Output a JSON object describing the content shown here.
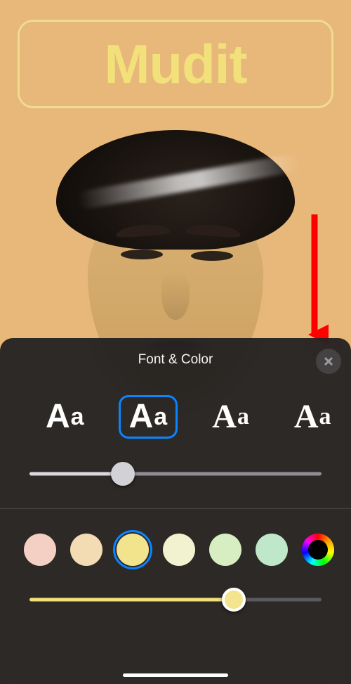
{
  "editor": {
    "name_text": "Mudit"
  },
  "arrow": {
    "color": "#ff0000"
  },
  "sheet": {
    "title": "Font & Color",
    "fonts": [
      {
        "label_big": "A",
        "label_small": "a",
        "style": "sans",
        "selected": false
      },
      {
        "label_big": "A",
        "label_small": "a",
        "style": "rounded",
        "selected": true
      },
      {
        "label_big": "A",
        "label_small": "a",
        "style": "serif",
        "selected": false
      },
      {
        "label_big": "A",
        "label_small": "a",
        "style": "slab",
        "selected": false
      }
    ],
    "weight_slider": {
      "value_pct": 32
    },
    "colors": [
      {
        "hex": "#f4cfc4",
        "selected": false
      },
      {
        "hex": "#f3dcb4",
        "selected": false
      },
      {
        "hex": "#f2e48d",
        "selected": true
      },
      {
        "hex": "#f2f2d0",
        "selected": false
      },
      {
        "hex": "#d7edc2",
        "selected": false
      },
      {
        "hex": "#bfe7c9",
        "selected": false
      },
      {
        "rainbow": true,
        "selected": false
      }
    ],
    "brightness_slider": {
      "value_pct": 70
    }
  }
}
